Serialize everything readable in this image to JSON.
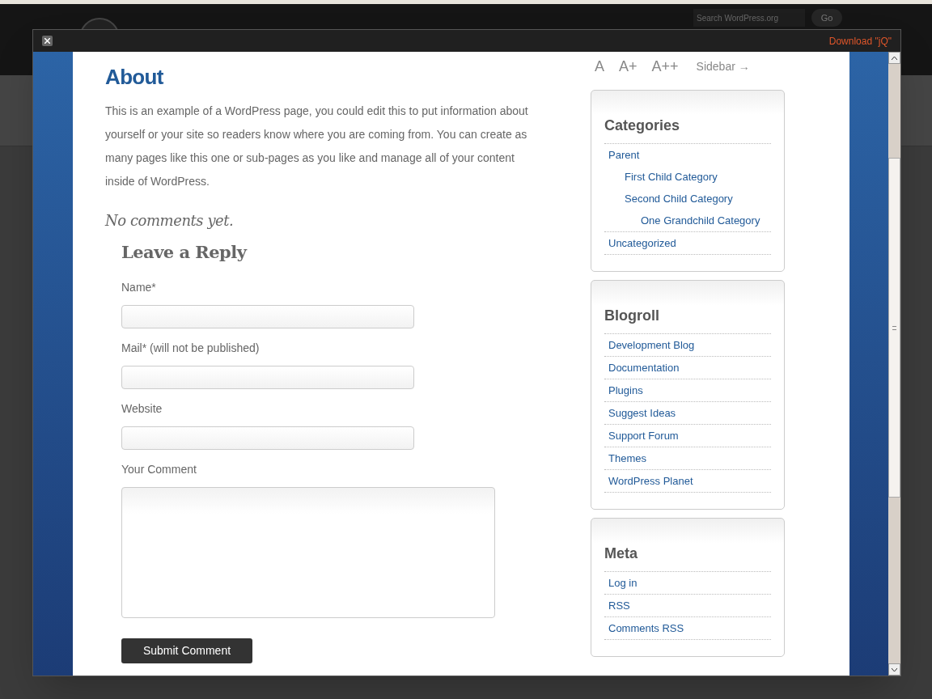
{
  "header": {
    "search": {
      "placeholder": "Search WordPress.org"
    },
    "go_button": "Go"
  },
  "modal": {
    "download_link": "Download \"jQ\"",
    "font_sizes": [
      "A",
      "A+",
      "A++"
    ],
    "sidebar_toggle": "Sidebar →",
    "page": {
      "title": "About",
      "body": "This is an example of a WordPress page, you could edit this to put information about yourself or your site so readers know where you are coming from. You can create as many pages like this one or sub-pages as you like and manage all of your content inside of WordPress.",
      "comments_note": "No comments yet.",
      "reply": {
        "title": "Leave a Reply",
        "fields": [
          {
            "label": "Name*",
            "kind": "input"
          },
          {
            "label": "Mail* (will not be published)",
            "kind": "input"
          },
          {
            "label": "Website",
            "kind": "input"
          },
          {
            "label": "Your Comment",
            "kind": "textarea"
          }
        ],
        "submit": "Submit Comment"
      }
    },
    "widgets": [
      {
        "title": "Categories",
        "items": [
          {
            "label": "Parent",
            "children": [
              {
                "label": "First Child Category"
              },
              {
                "label": "Second Child Category",
                "children": [
                  {
                    "label": "One Grandchild Category"
                  }
                ]
              }
            ]
          },
          {
            "label": "Uncategorized"
          }
        ]
      },
      {
        "title": "Blogroll",
        "items": [
          {
            "label": "Development Blog"
          },
          {
            "label": "Documentation"
          },
          {
            "label": "Plugins"
          },
          {
            "label": "Suggest Ideas"
          },
          {
            "label": "Support Forum"
          },
          {
            "label": "Themes"
          },
          {
            "label": "WordPress Planet"
          }
        ]
      },
      {
        "title": "Meta",
        "items": [
          {
            "label": "Log in"
          },
          {
            "label": "RSS"
          },
          {
            "label": "Comments RSS"
          }
        ]
      }
    ]
  }
}
